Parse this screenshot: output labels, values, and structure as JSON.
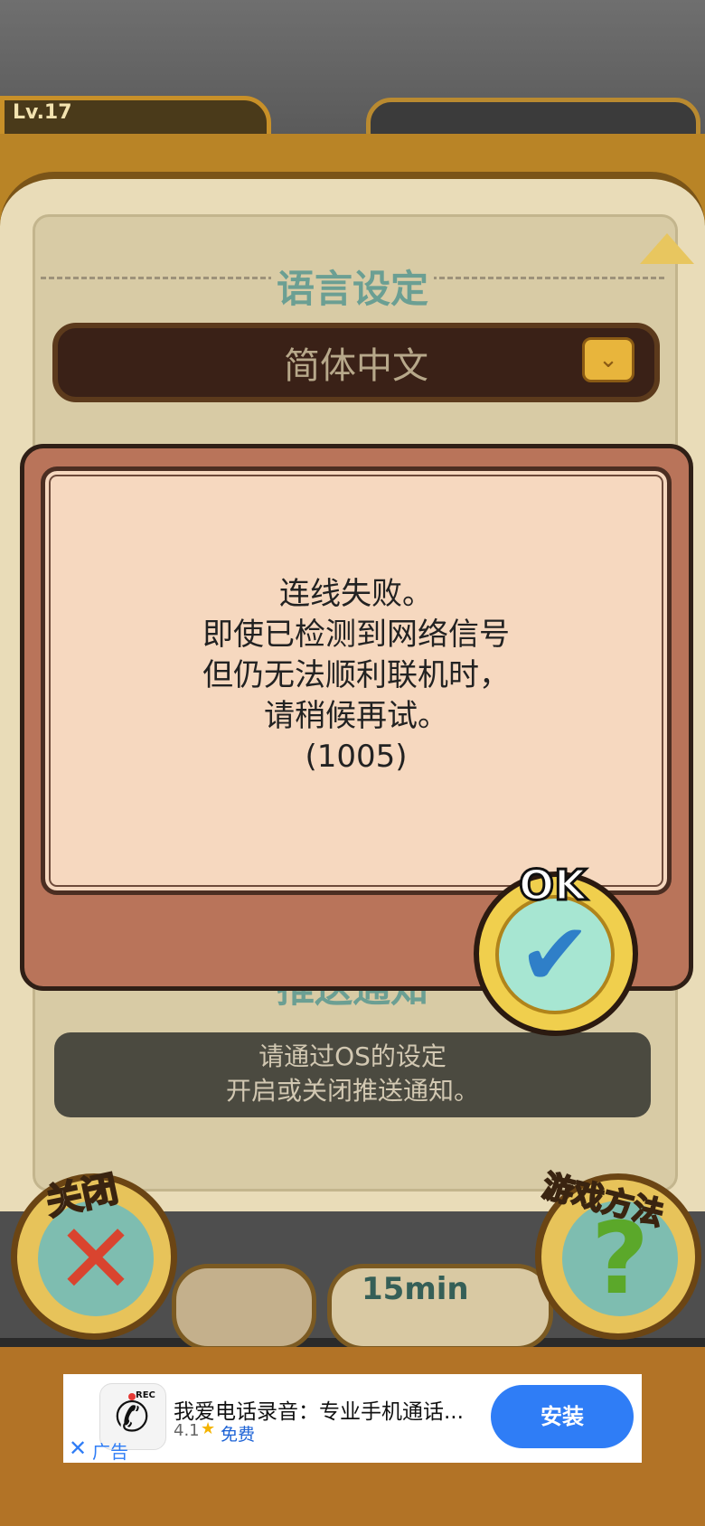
{
  "game_header": {
    "level": "Lv.17"
  },
  "settings": {
    "language_title": "语言设定",
    "language_value": "简体中文",
    "push_title": "推送通知",
    "push_text_line1": "请通过OS的设定",
    "push_text_line2": "开启或关闭推送通知。"
  },
  "dialog": {
    "line1": "连线失败。",
    "line2": "即使已检测到网络信号",
    "line3": "但仍无法顺利联机时，",
    "line4": "请稍候再试。",
    "line5": "(1005)",
    "ok_label": "OK"
  },
  "bottom_buttons": {
    "close_label": "关闭",
    "help_label": "游戏方法",
    "timer_text": "15min"
  },
  "ad": {
    "title": "我爱电话录音：专业手机通话...",
    "rating": "4.1",
    "price": "免费",
    "install_label": "安装",
    "ad_label": "广告",
    "rec_badge": "REC"
  },
  "icons": {
    "dropdown": "chevron-down-icon",
    "close": "x-icon",
    "help": "question-icon",
    "ok": "checkmark-icon",
    "ad_app": "phone-icon"
  },
  "colors": {
    "panel_gold": "#b98426",
    "dialog_frame": "#b9745a",
    "dialog_body": "#f6d8bf",
    "accent_teal": "#6b9f93",
    "install_blue": "#2f7df6"
  }
}
